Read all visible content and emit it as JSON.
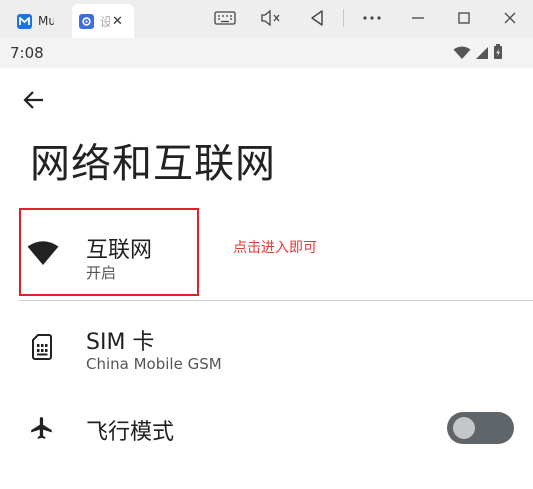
{
  "emulator": {
    "tabs": [
      {
        "title": "Mu",
        "icon": "mumu-app-icon"
      },
      {
        "title": "设",
        "icon": "settings-gear-icon"
      }
    ],
    "toolbar": [
      "keyboard-icon",
      "volume-mute-icon",
      "back-triangle-icon",
      "more-icon",
      "minimize-icon",
      "maximize-icon",
      "close-icon"
    ]
  },
  "statusbar": {
    "time": "7:08"
  },
  "page": {
    "title": "网络和互联网"
  },
  "rows": [
    {
      "title": "互联网",
      "subtitle": "开启",
      "icon": "wifi-icon"
    },
    {
      "title": "SIM 卡",
      "subtitle": "China Mobile GSM",
      "icon": "sim-card-icon"
    },
    {
      "title": "飞行模式",
      "icon": "airplane-icon",
      "toggle": "off"
    }
  ],
  "annotation": {
    "text": "点击进入即可",
    "color": "#e53935"
  },
  "colors": {
    "highlight": "#e0202a",
    "toggle_track": "#5f6569"
  }
}
